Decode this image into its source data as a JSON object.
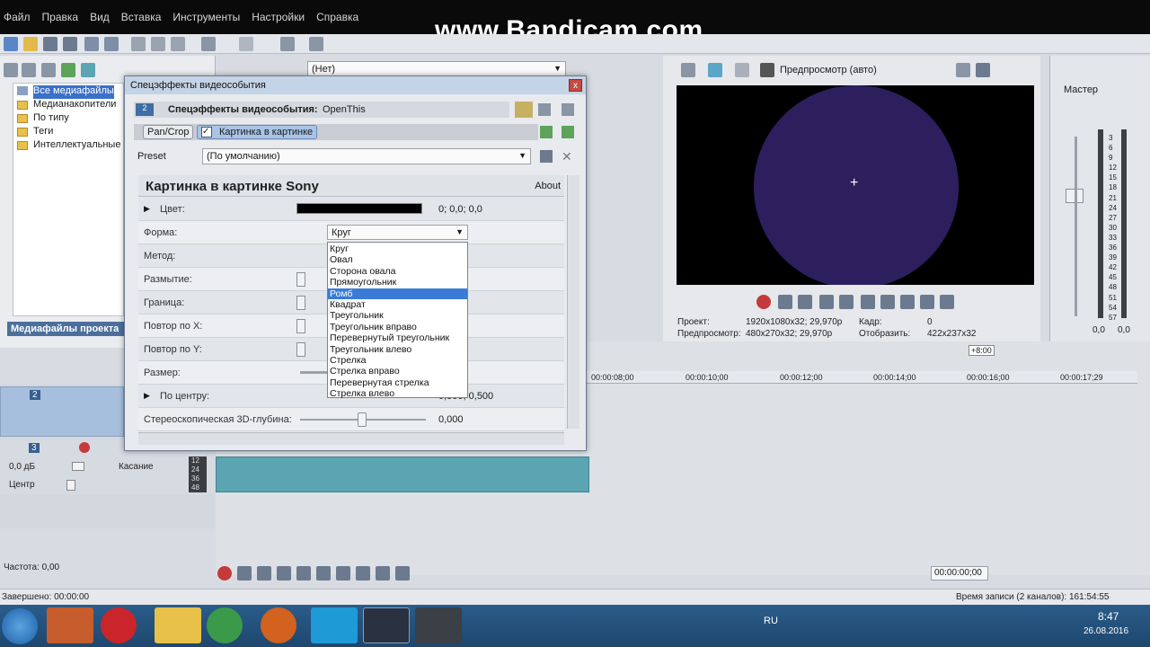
{
  "menu": [
    "Файл",
    "Правка",
    "Вид",
    "Вставка",
    "Инструменты",
    "Настройки",
    "Справка"
  ],
  "watermark": "www.Bandicam.com",
  "media_panel": {
    "tree_items": [
      "Все медиафайлы",
      "Медианакопители",
      "По типу",
      "Теги",
      "Интеллектуальные"
    ],
    "tab_label": "Медиафайлы проекта"
  },
  "fx_toolbar": {
    "preset_value": "(Нет)"
  },
  "dialog": {
    "title": "Спецэффекты видеособытия",
    "track_badge": "2",
    "header_label": "Спецэффекты видеособытия:",
    "header_value": "OpenThis",
    "chain": [
      "Pan/Crop",
      "Картинка в картинке"
    ],
    "preset_label": "Preset",
    "preset_value": "(По умолчанию)",
    "plugin_name": "Картинка в картинке Sony",
    "about": "About",
    "params": [
      {
        "label": "Цвет:",
        "value": "0; 0,0; 0,0"
      },
      {
        "label": "Форма:",
        "value": "Круг"
      },
      {
        "label": "Метод:",
        "value": ""
      },
      {
        "label": "Размытие:",
        "value": ""
      },
      {
        "label": "Граница:",
        "value": ""
      },
      {
        "label": "Повтор по X:",
        "value": ""
      },
      {
        "label": "Повтор по Y:",
        "value": ""
      },
      {
        "label": "Размер:",
        "value": ""
      },
      {
        "label": "По центру:",
        "value": "0,500; 0,500"
      },
      {
        "label": "Стереоскопическая 3D-глубина:",
        "value": "0,000"
      }
    ],
    "shape_options": [
      "Круг",
      "Овал",
      "Сторона овала",
      "Прямоугольник",
      "Ромб",
      "Квадрат",
      "Треугольник",
      "Треугольник вправо",
      "Перевернутый треугольник",
      "Треугольник влево",
      "Стрелка",
      "Стрелка вправо",
      "Перевернутая стрелка",
      "Стрелка влево"
    ],
    "shape_selected_index": 4
  },
  "preview": {
    "mode": "Предпросмотр (авто)",
    "project_label": "Проект:",
    "project_value": "1920x1080x32; 29,970p",
    "preview_label": "Предпросмотр:",
    "preview_value": "480x270x32; 29,970p",
    "frame_label": "Кадр:",
    "frame_value": "0",
    "display_label": "Отобразить:",
    "display_value": "422x237x32"
  },
  "mixer": {
    "title": "Мастер",
    "scale": [
      "3",
      "6",
      "9",
      "12",
      "15",
      "18",
      "21",
      "24",
      "27",
      "30",
      "33",
      "36",
      "39",
      "42",
      "45",
      "48",
      "51",
      "54",
      "57"
    ],
    "left_value": "0,0",
    "right_value": "0,0"
  },
  "timeline": {
    "ruler": [
      "00:00:08;00",
      "00:00:10;00",
      "00:00:12;00",
      "00:00:14;00",
      "00:00:16;00",
      "00:00:17;29"
    ],
    "marker": "+8:00",
    "track2_num": "2",
    "track3_num": "3",
    "audio_db": "0,0 дБ",
    "audio_pan": "Центр",
    "audio_mode": "Касание",
    "meter_labels": [
      "12",
      "24",
      "36",
      "48"
    ]
  },
  "transport": {
    "rate": "Частота: 0,00",
    "time": "00:00:00;00"
  },
  "status": {
    "left": "Завершено: 00:00:00",
    "right": "Время записи (2 каналов): 161:54:55"
  },
  "taskbar": {
    "lang": "RU",
    "time": "8:47",
    "date": "26.08.2016"
  }
}
